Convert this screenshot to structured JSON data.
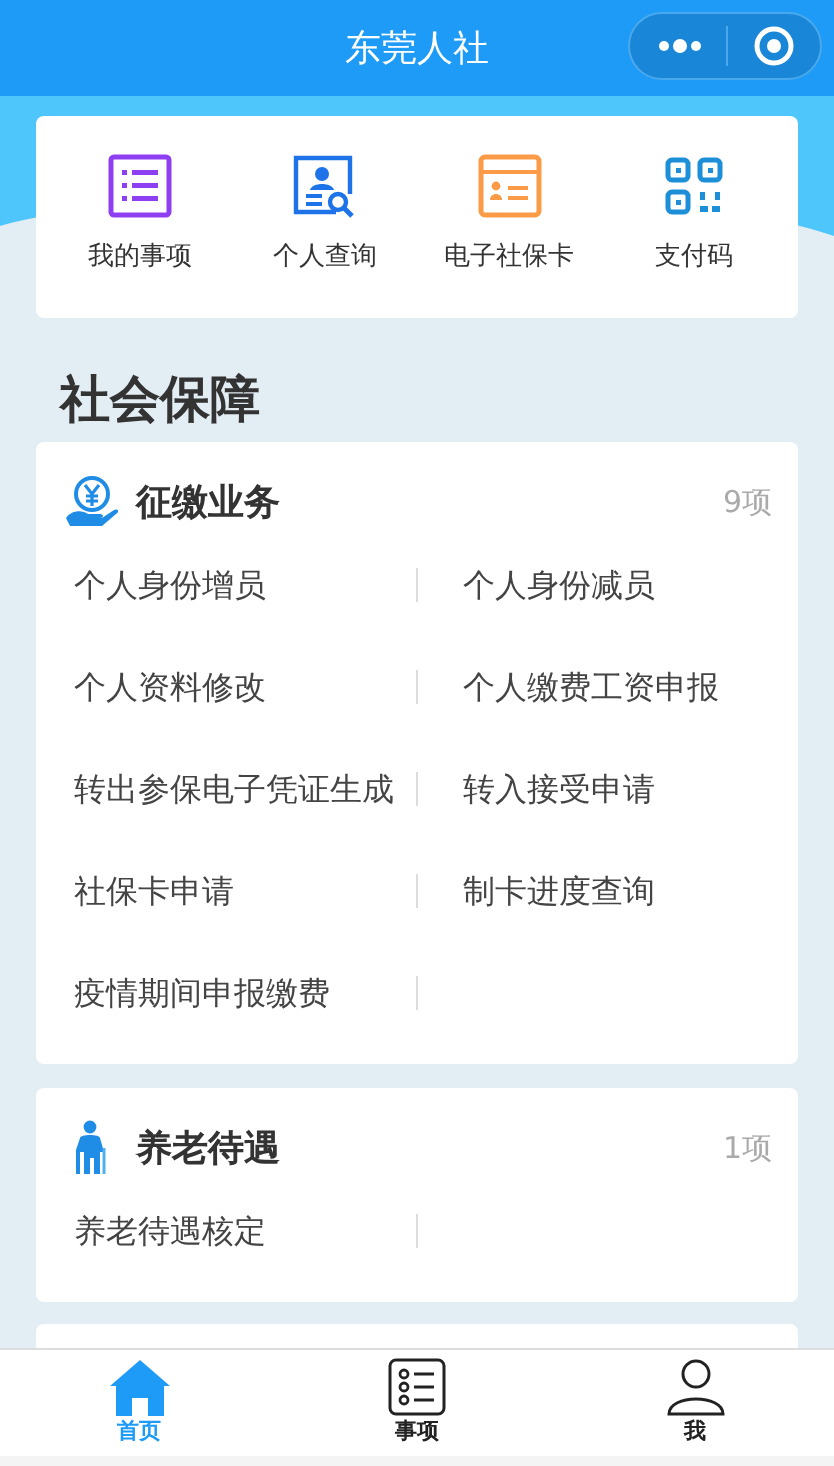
{
  "header": {
    "title": "东莞人社"
  },
  "quick_actions": [
    {
      "kind": "list",
      "label": "我的事项"
    },
    {
      "kind": "query",
      "label": "个人查询"
    },
    {
      "kind": "card",
      "label": "电子社保卡"
    },
    {
      "kind": "qr",
      "label": "支付码"
    }
  ],
  "section_title": "社会保障",
  "groups": [
    {
      "kind": "payment",
      "title": "征缴业务",
      "count": "9项",
      "items": [
        "个人身份增员",
        "个人身份减员",
        "个人资料修改",
        "个人缴费工资申报",
        "转出参保电子凭证生成",
        "转入接受申请",
        "社保卡申请",
        "制卡进度查询",
        "疫情期间申报缴费"
      ]
    },
    {
      "kind": "elderly",
      "title": "养老待遇",
      "count": "1项",
      "items": [
        "养老待遇核定"
      ]
    }
  ],
  "tabs": [
    {
      "kind": "home",
      "label": "首页",
      "selected": true
    },
    {
      "kind": "list",
      "label": "事项",
      "selected": false
    },
    {
      "kind": "user",
      "label": "我",
      "selected": false
    }
  ]
}
